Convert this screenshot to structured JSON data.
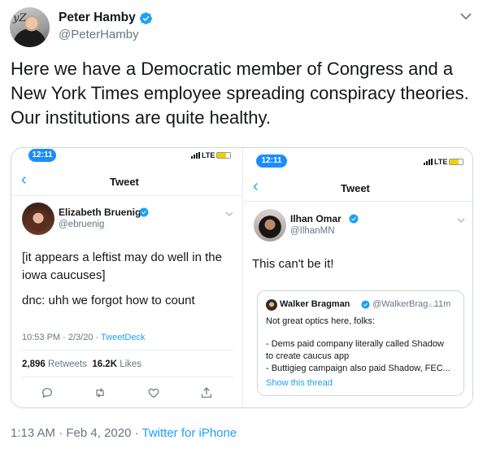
{
  "author": {
    "name": "Peter Hamby",
    "handle": "@PeterHamby",
    "avatar_text": "yZ"
  },
  "tweet_text": "Here we have a Democratic member of Congress and a New York Times employee spreading conspiracy theories. Our institutions are quite healthy.",
  "media": {
    "left": {
      "status_time": "12:11",
      "network": "LTE",
      "nav_title": "Tweet",
      "author_name": "Elizabeth Bruenig",
      "author_handle": "@ebruenig",
      "text_line1": "[it appears a leftist may do well in the",
      "text_line2": "iowa caucuses]",
      "text_line3": "dnc: uhh we forgot how to count",
      "timestamp": "10:53 PM · 2/3/20 · ",
      "source": "TweetDeck",
      "retweets_count": "2,896",
      "retweets_label": "Retweets",
      "likes_count": "16.2K",
      "likes_label": "Likes"
    },
    "right": {
      "status_time": "12:11",
      "network": "LTE",
      "nav_title": "Tweet",
      "author_name": "Ilhan Omar",
      "author_handle": "@IlhanMN",
      "text": "This can't be it!",
      "quote": {
        "name": "Walker Bragman",
        "handle": "@WalkerBrag...",
        "time": "· 11m",
        "line1": "Not great optics here, folks:",
        "line2": "- Dems paid company literally called Shadow",
        "line3": "to create caucus app",
        "line4": "- Buttigieg campaign also paid Shadow, FEC...",
        "show_thread": "Show this thread"
      }
    }
  },
  "footer": {
    "timestamp": "1:13 AM · Feb 4, 2020 · ",
    "source": "Twitter for iPhone"
  },
  "colors": {
    "accent": "#1da1f2",
    "text": "#14171a",
    "secondary": "#657786",
    "border": "#ccd6dd"
  }
}
